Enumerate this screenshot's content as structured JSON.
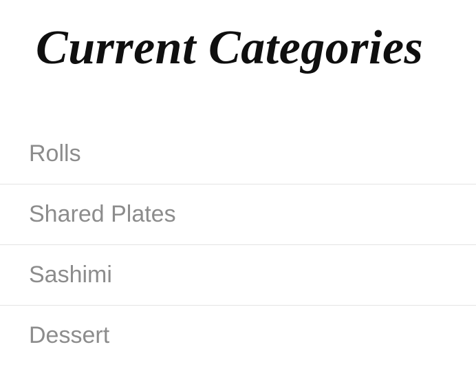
{
  "heading": "Current Categories",
  "categories": [
    {
      "label": "Rolls"
    },
    {
      "label": "Shared Plates"
    },
    {
      "label": "Sashimi"
    },
    {
      "label": "Dessert"
    }
  ]
}
